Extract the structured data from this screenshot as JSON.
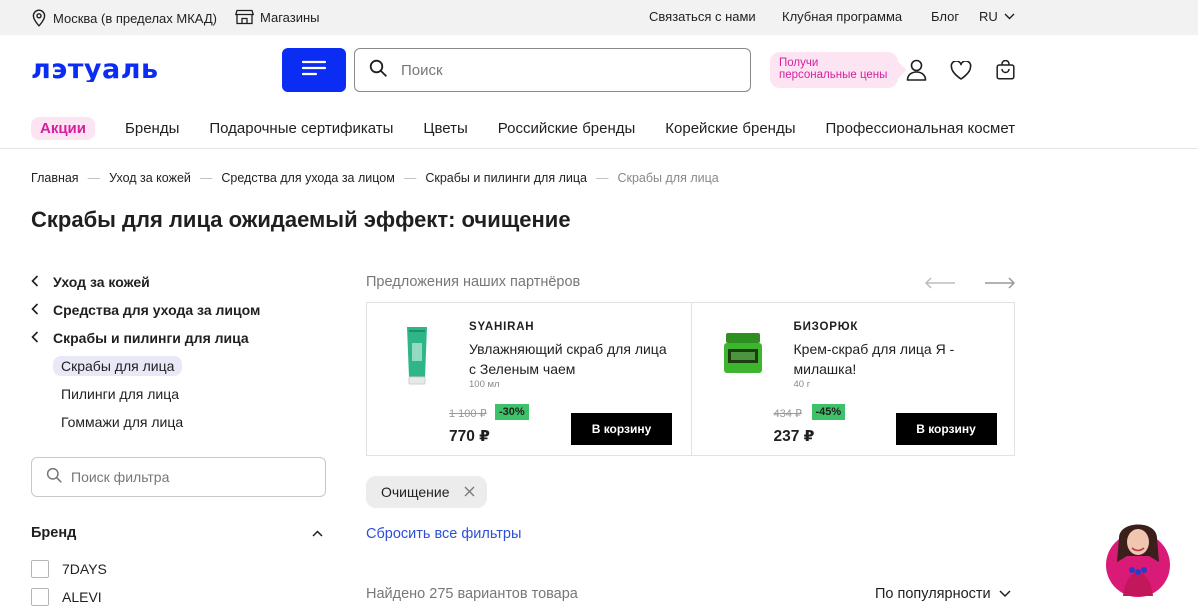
{
  "topbar": {
    "location": "Москва (в пределах МКАД)",
    "stores": "Магазины",
    "contact": "Связаться с нами",
    "club": "Клубная программа",
    "blog": "Блог",
    "lang": "RU"
  },
  "header": {
    "logo": "лэтуаль",
    "search_placeholder": "Поиск",
    "promo_line1": "Получи",
    "promo_line2": "персональные цены"
  },
  "nav": {
    "promo": "Акции",
    "tabs": [
      "Бренды",
      "Подарочные сертификаты",
      "Цветы",
      "Российские бренды",
      "Корейские бренды",
      "Профессиональная косметика"
    ]
  },
  "breadcrumb": [
    "Главная",
    "Уход за кожей",
    "Средства для ухода за лицом",
    "Скрабы и пилинги для лица",
    "Скрабы для лица"
  ],
  "page_title": "Скрабы для лица ожидаемый эффект: очищение",
  "sidebar": {
    "back_categories": [
      "Уход за кожей",
      "Средства для ухода за лицом",
      "Скрабы и пилинги для лица"
    ],
    "active": "Скрабы для лица",
    "subs": [
      "Пилинги для лица",
      "Гоммажи для лица"
    ],
    "filter_placeholder": "Поиск фильтра",
    "brand_title": "Бренд",
    "brands": [
      "7DAYS",
      "ALEVI"
    ]
  },
  "partners": {
    "title": "Предложения наших партнёров",
    "products": [
      {
        "brand": "SYAHIRAH",
        "name": "Увлажняющий скраб для лица с Зеленым чаем",
        "volume": "100 мл",
        "old_price": "1 100 ₽",
        "discount": "-30%",
        "price": "770 ₽",
        "button": "В корзину"
      },
      {
        "brand": "БИЗОРЮК",
        "name": "Крем-скраб для лица Я - милашка!",
        "volume": "40 г",
        "old_price": "434 ₽",
        "discount": "-45%",
        "price": "237 ₽",
        "button": "В корзину"
      }
    ]
  },
  "filters": {
    "chip": "Очищение",
    "reset": "Сбросить все фильтры"
  },
  "results": {
    "found": "Найдено 275 вариантов товара",
    "sort": "По популярности"
  },
  "colors": {
    "accent_blue": "#0b2cf3",
    "promo_pink": "#d61fa0",
    "discount_green": "#3ec169"
  }
}
